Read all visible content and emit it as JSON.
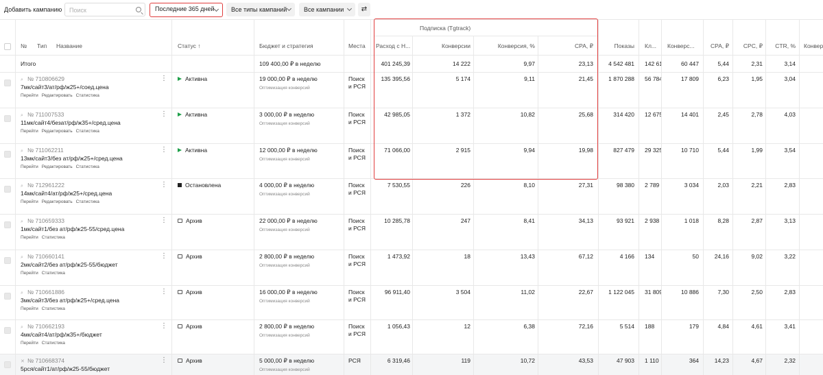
{
  "toolbar": {
    "add_campaign": "Добавить кампанию",
    "search_placeholder": "Поиск",
    "period": "Последние 365 дней",
    "types": "Все типы кампаний",
    "campaigns": "Все кампании",
    "swap_icon": "⇄"
  },
  "group_header": "Подписка (Tgtrack)",
  "columns": {
    "num": "№",
    "type": "Тип",
    "name": "Название",
    "status": "Статус ↑",
    "budget": "Бюджет и стратегия",
    "places": "Места",
    "spend": "Расход с Н...",
    "conv": "Конверсии",
    "conv_pct": "Конверсия, %",
    "cpa_group": "CPA, ₽",
    "shows": "Показы",
    "clicks": "Кл...",
    "conv2": "Конверс...",
    "cpa": "CPA, ₽",
    "cpc": "CPC, ₽",
    "ctr": "CTR, %",
    "conv3": "Конвер"
  },
  "total": {
    "label": "Итого",
    "budget": "109 400,00 ₽ в неделю",
    "spend": "401 245,39",
    "conv": "14 222",
    "conv_pct": "9,97",
    "cpa_group": "23,13",
    "shows": "4 542 481",
    "clicks": "142 613",
    "conv2": "60 447",
    "cpa": "5,44",
    "cpc": "2,31",
    "ctr": "3,14"
  },
  "rows": [
    {
      "id": "№ 710806629",
      "name": "7мк/сайт3/ат/рф/ж25+/соед.цена",
      "links": [
        "Перейти",
        "Редактировать",
        "Статистика"
      ],
      "status": "Активна",
      "status_kind": "active",
      "budget": "19 000,00 ₽ в неделю",
      "strategy": "Оптимизация конверсий",
      "places": "Поиск\nи РСЯ",
      "spend": "135 395,56",
      "conv": "5 174",
      "conv_pct": "9,11",
      "cpa_group": "21,45",
      "shows": "1 870 288",
      "clicks": "56 784",
      "conv2": "17 809",
      "cpa": "6,23",
      "cpc": "1,95",
      "ctr": "3,04"
    },
    {
      "id": "№ 711007533",
      "name": "11мк/сайт4/безат/рф/ж35+/сред.цена",
      "links": [
        "Перейти",
        "Редактировать",
        "Статистика"
      ],
      "status": "Активна",
      "status_kind": "active",
      "budget": "3 000,00 ₽ в неделю",
      "strategy": "Оптимизация конверсий",
      "places": "Поиск\nи РСЯ",
      "spend": "42 985,05",
      "conv": "1 372",
      "conv_pct": "10,82",
      "cpa_group": "25,68",
      "shows": "314 420",
      "clicks": "12 675",
      "conv2": "14 401",
      "cpa": "2,45",
      "cpc": "2,78",
      "ctr": "4,03"
    },
    {
      "id": "№ 711062211",
      "name": "13мк/сайт3/без ат/рф/ж25+/сред.цена",
      "links": [
        "Перейти",
        "Редактировать",
        "Статистика"
      ],
      "status": "Активна",
      "status_kind": "active",
      "budget": "12 000,00 ₽ в неделю",
      "strategy": "Оптимизация конверсий",
      "places": "Поиск\nи РСЯ",
      "spend": "71 066,00",
      "conv": "2 915",
      "conv_pct": "9,94",
      "cpa_group": "19,98",
      "shows": "827 479",
      "clicks": "29 325",
      "conv2": "10 710",
      "cpa": "5,44",
      "cpc": "1,99",
      "ctr": "3,54"
    },
    {
      "id": "№ 712961222",
      "name": "14мк/сайт4/ат/рф/ж25+/сред.цена",
      "links": [
        "Перейти",
        "Редактировать",
        "Статистика"
      ],
      "status": "Остановлена",
      "status_kind": "stopped",
      "budget": "4 000,00 ₽ в неделю",
      "strategy": "Оптимизация конверсий",
      "places": "Поиск\nи РСЯ",
      "spend": "7 530,55",
      "conv": "226",
      "conv_pct": "8,10",
      "cpa_group": "27,31",
      "shows": "98 380",
      "clicks": "2 789",
      "conv2": "3 034",
      "cpa": "2,03",
      "cpc": "2,21",
      "ctr": "2,83"
    },
    {
      "id": "№ 710659333",
      "name": "1мк/сайт1/без ат/рф/ж25-55/сред.цена",
      "links": [
        "Перейти",
        "Статистика"
      ],
      "status": "Архив",
      "status_kind": "archive",
      "budget": "22 000,00 ₽ в неделю",
      "strategy": "Оптимизация конверсий",
      "places": "Поиск\nи РСЯ",
      "spend": "10 285,78",
      "conv": "247",
      "conv_pct": "8,41",
      "cpa_group": "34,13",
      "shows": "93 921",
      "clicks": "2 938",
      "conv2": "1 018",
      "cpa": "8,28",
      "cpc": "2,87",
      "ctr": "3,13"
    },
    {
      "id": "№ 710660141",
      "name": "2мк/сайт2/без ат/рф/ж25-55/бюджет",
      "links": [
        "Перейти",
        "Статистика"
      ],
      "status": "Архив",
      "status_kind": "archive",
      "budget": "2 800,00 ₽ в неделю",
      "strategy": "Оптимизация конверсий",
      "places": "Поиск\nи РСЯ",
      "spend": "1 473,92",
      "conv": "18",
      "conv_pct": "13,43",
      "cpa_group": "67,12",
      "shows": "4 166",
      "clicks": "134",
      "conv2": "50",
      "cpa": "24,16",
      "cpc": "9,02",
      "ctr": "3,22"
    },
    {
      "id": "№ 710661886",
      "name": "3мк/сайт3/без ат/рф/ж25+/сред.цена",
      "links": [
        "Перейти",
        "Статистика"
      ],
      "status": "Архив",
      "status_kind": "archive",
      "budget": "16 000,00 ₽ в неделю",
      "strategy": "Оптимизация конверсий",
      "places": "Поиск\nи РСЯ",
      "spend": "96 911,40",
      "conv": "3 504",
      "conv_pct": "11,02",
      "cpa_group": "22,67",
      "shows": "1 122 045",
      "clicks": "31 809",
      "conv2": "10 886",
      "cpa": "7,30",
      "cpc": "2,50",
      "ctr": "2,83"
    },
    {
      "id": "№ 710662193",
      "name": "4мк/сайт4/ат/рф/ж35+/бюджет",
      "links": [
        "Перейти",
        "Статистика"
      ],
      "status": "Архив",
      "status_kind": "archive",
      "budget": "2 800,00 ₽ в неделю",
      "strategy": "Оптимизация конверсий",
      "places": "Поиск\nи РСЯ",
      "spend": "1 056,43",
      "conv": "12",
      "conv_pct": "6,38",
      "cpa_group": "72,16",
      "shows": "5 514",
      "clicks": "188",
      "conv2": "179",
      "cpa": "4,84",
      "cpc": "4,61",
      "ctr": "3,41"
    },
    {
      "id": "№ 710668374",
      "name": "5рся/сайт1/ат/рф/ж25-55/бюджет",
      "links": [],
      "status": "Архив",
      "status_kind": "archive",
      "budget": "5 000,00 ₽ в неделю",
      "strategy": "Оптимизация конверсий",
      "places": "РСЯ",
      "spend": "6 319,46",
      "conv": "119",
      "conv_pct": "10,72",
      "cpa_group": "43,53",
      "shows": "47 903",
      "clicks": "1 110",
      "conv2": "364",
      "cpa": "14,23",
      "cpc": "4,67",
      "ctr": "2,32"
    }
  ]
}
